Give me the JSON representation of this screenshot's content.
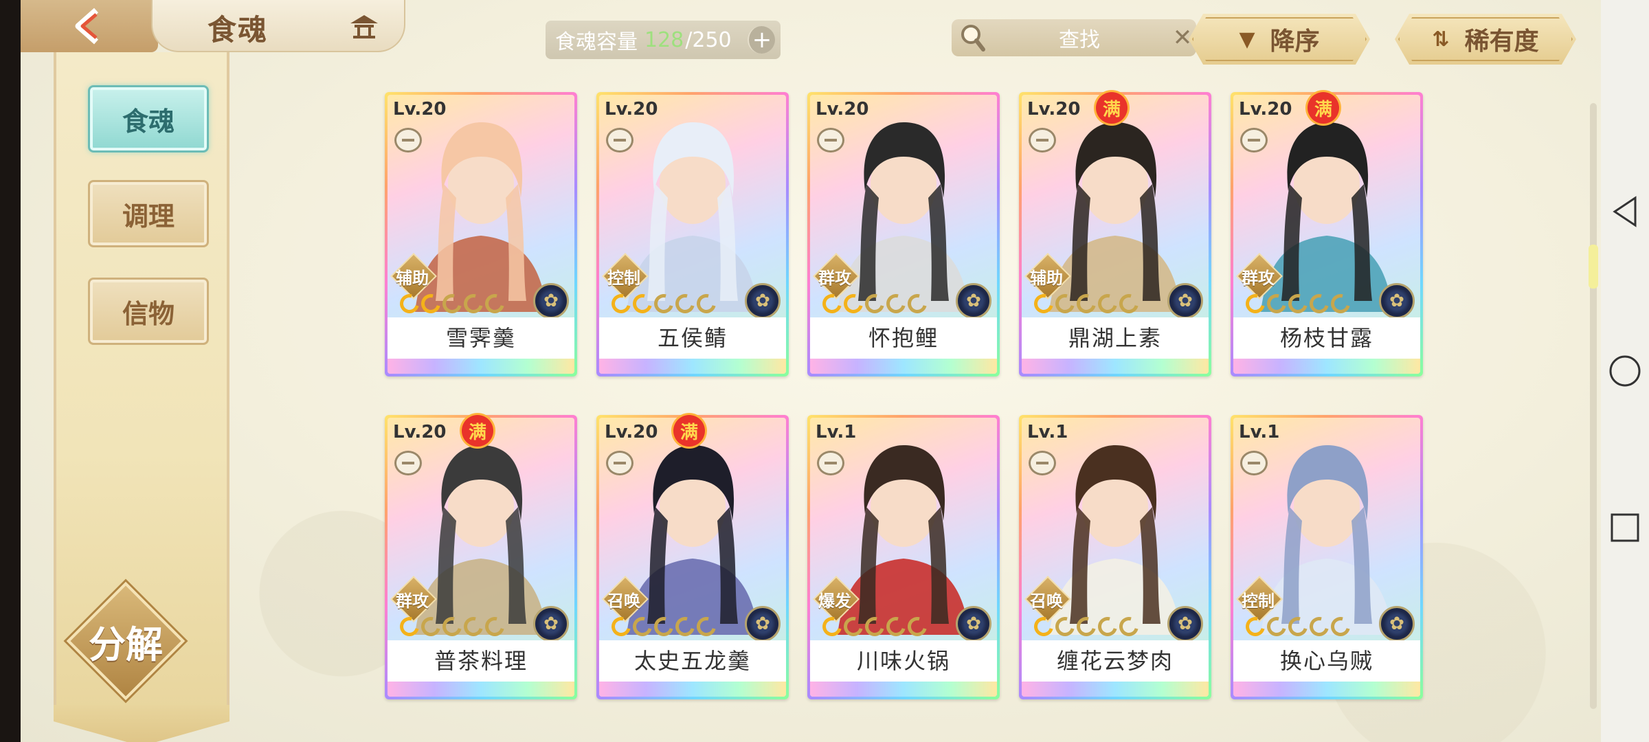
{
  "header": {
    "title": "食魂",
    "capacity_label": "食魂容量",
    "capacity_current": "128",
    "capacity_total": "/250",
    "search_label": "查找",
    "sort_order_label": "降序",
    "sort_key_label": "稀有度"
  },
  "sidebar": {
    "items": [
      {
        "label": "食魂"
      },
      {
        "label": "调理"
      },
      {
        "label": "信物"
      }
    ],
    "decompose_label": "分解"
  },
  "cards": [
    {
      "level": "Lv.20",
      "name": "雪霁羹",
      "role": "辅助",
      "stars_on": 2,
      "full": false
    },
    {
      "level": "Lv.20",
      "name": "五侯鲭",
      "role": "控制",
      "stars_on": 2,
      "full": false
    },
    {
      "level": "Lv.20",
      "name": "怀抱鲤",
      "role": "群攻",
      "stars_on": 2,
      "full": false
    },
    {
      "level": "Lv.20",
      "name": "鼎湖上素",
      "role": "辅助",
      "stars_on": 1,
      "full": true
    },
    {
      "level": "Lv.20",
      "name": "杨枝甘露",
      "role": "群攻",
      "stars_on": 1,
      "full": true
    },
    {
      "level": "Lv.20",
      "name": "普茶料理",
      "role": "群攻",
      "stars_on": 1,
      "full": true
    },
    {
      "level": "Lv.20",
      "name": "太史五龙羹",
      "role": "召唤",
      "stars_on": 1,
      "full": true
    },
    {
      "level": "Lv.1",
      "name": "川味火锅",
      "role": "爆发",
      "stars_on": 1,
      "full": false
    },
    {
      "level": "Lv.1",
      "name": "缠花云梦肉",
      "role": "召唤",
      "stars_on": 1,
      "full": false
    },
    {
      "level": "Lv.1",
      "name": "换心乌贼",
      "role": "控制",
      "stars_on": 1,
      "full": false
    }
  ],
  "full_badge_text": "满",
  "colors": {
    "accent_teal": "#8fd8d1",
    "gold": "#c59e6a",
    "capacity_green": "#9ee07e",
    "full_badge_red": "#e9332a"
  },
  "icons": {
    "back": "back-arrow-icon",
    "home": "pavilion-icon",
    "search": "magnifier-icon",
    "clear": "close-icon",
    "sort_order": "triangle-down-icon",
    "sort_key": "sort-swap-icon",
    "element": "element-flower-icon"
  }
}
